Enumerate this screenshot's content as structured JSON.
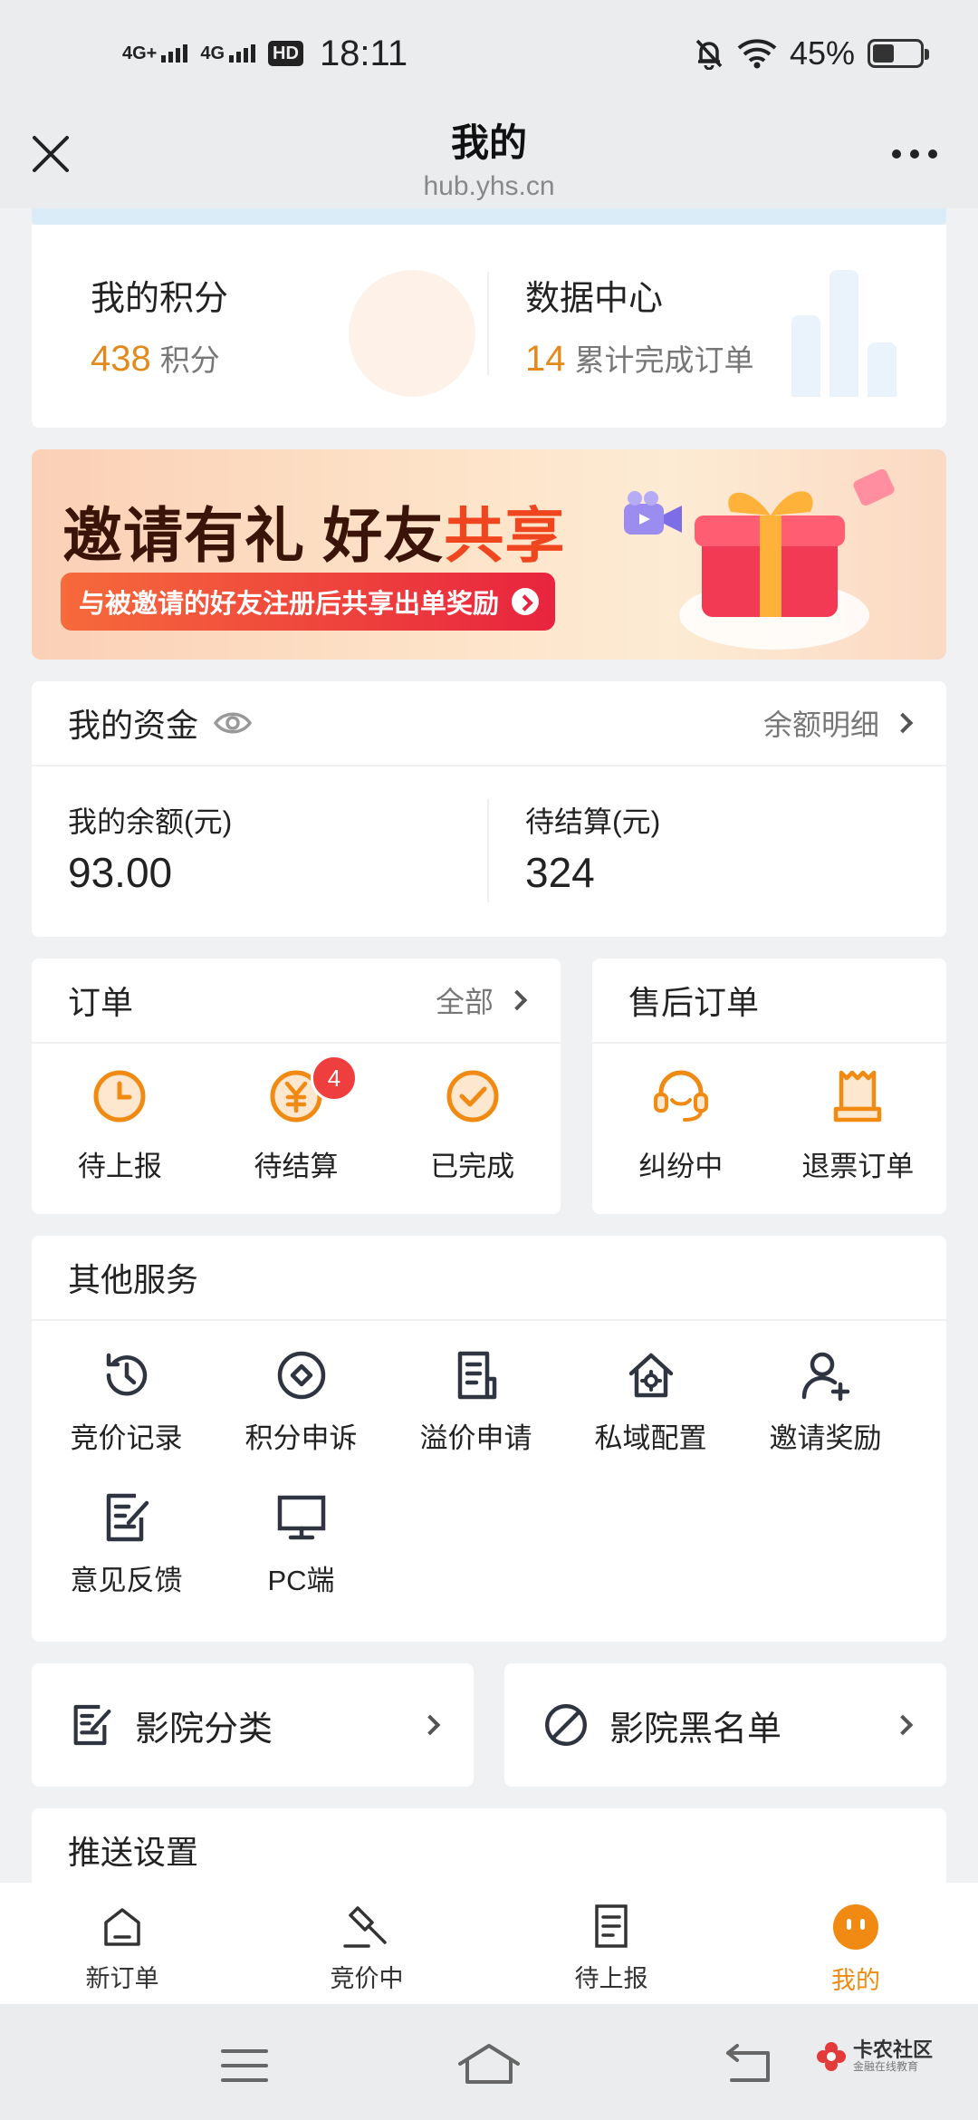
{
  "status_bar": {
    "signal1": "4G+",
    "signal2": "4G",
    "hd": "HD",
    "time": "18:11",
    "battery_pct": "45%",
    "battery_level": 0.45
  },
  "titlebar": {
    "title": "我的",
    "url": "hub.yhs.cn"
  },
  "points": {
    "label": "我的积分",
    "value": "438",
    "unit": "积分"
  },
  "data_center": {
    "label": "数据中心",
    "value": "14",
    "unit": "累计完成订单"
  },
  "banner": {
    "title_part1": "邀请有礼 好友",
    "title_part2": "共享",
    "subtitle": "与被邀请的好友注册后共享出单奖励"
  },
  "funds": {
    "title": "我的资金",
    "link": "余额明细",
    "balance_label": "我的余额(元)",
    "balance_value": "93.00",
    "pending_label": "待结算(元)",
    "pending_value": "324"
  },
  "orders": {
    "title": "订单",
    "link": "全部",
    "items": [
      {
        "label": "待上报",
        "badge": ""
      },
      {
        "label": "待结算",
        "badge": "4"
      },
      {
        "label": "已完成",
        "badge": ""
      }
    ]
  },
  "after_sales": {
    "title": "售后订单",
    "items": [
      {
        "label": "纠纷中"
      },
      {
        "label": "退票订单"
      }
    ]
  },
  "services": {
    "title": "其他服务",
    "items": [
      {
        "label": "竞价记录",
        "icon": "history-icon"
      },
      {
        "label": "积分申诉",
        "icon": "diamond-icon"
      },
      {
        "label": "溢价申请",
        "icon": "document-icon"
      },
      {
        "label": "私域配置",
        "icon": "home-gear-icon"
      },
      {
        "label": "邀请奖励",
        "icon": "user-add-icon"
      },
      {
        "label": "意见反馈",
        "icon": "edit-icon"
      },
      {
        "label": "PC端",
        "icon": "monitor-icon"
      }
    ]
  },
  "cinema": {
    "category": "影院分类",
    "blacklist": "影院黑名单"
  },
  "push": {
    "title": "推送设置"
  },
  "tabs": [
    {
      "label": "新订单",
      "icon": "home-icon"
    },
    {
      "label": "竞价中",
      "icon": "gavel-icon"
    },
    {
      "label": "待上报",
      "icon": "list-icon"
    },
    {
      "label": "我的",
      "icon": "profile-face-icon"
    }
  ],
  "watermark": {
    "text": "卡农社区",
    "sub": "金融在线教育"
  },
  "colors": {
    "accent": "#f08a12",
    "badge": "#ef3e3e",
    "banner_highlight": "#f0461f"
  }
}
